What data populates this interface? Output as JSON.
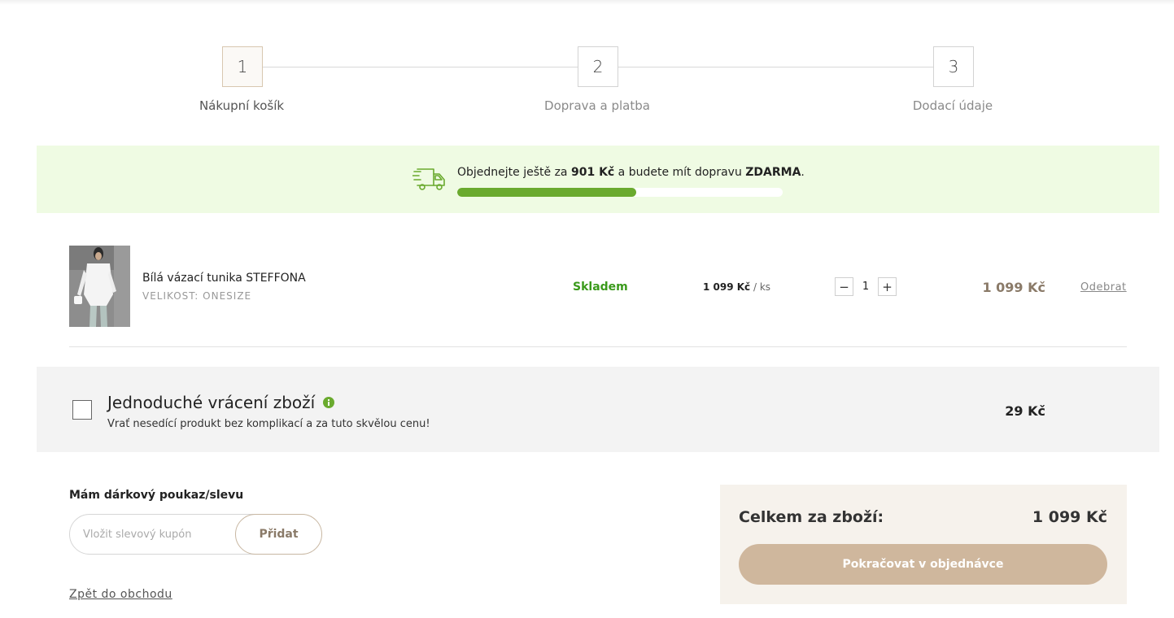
{
  "steps": [
    {
      "number": "1",
      "label": "Nákupní košík",
      "active": true
    },
    {
      "number": "2",
      "label": "Doprava a platba",
      "active": false
    },
    {
      "number": "3",
      "label": "Dodací údaje",
      "active": false
    }
  ],
  "shipping": {
    "text_before": "Objednejte ještě za",
    "remaining": "901 Kč",
    "text_middle": "a budete mít dopravu",
    "free_word": "ZDARMA",
    "text_after": ".",
    "progress_fraction": 0.55,
    "icon": "truck-icon",
    "accent_color": "#6aaa2e"
  },
  "cart": {
    "items": [
      {
        "name": "Bílá vázací tunika STEFFONA",
        "size": "VELIKOST: ONESIZE",
        "stock": "Skladem",
        "unit_price": "1 099 Kč",
        "unit_suffix": "/ ks",
        "quantity": "1",
        "qty_minus": "−",
        "qty_plus": "+",
        "line_total": "1 099 Kč",
        "remove_label": "Odebrat"
      }
    ]
  },
  "easy_return": {
    "title": "Jednoduché vrácení zboží",
    "description": "Vrať nesedící produkt bez komplikací a za tuto skvělou cenu!",
    "price": "29 Kč",
    "checked": false
  },
  "coupon": {
    "title": "Mám dárkový poukaz/slevu",
    "placeholder": "Vložit slevový kupón",
    "button_label": "Přidat"
  },
  "back_link": "Zpět do obchodu",
  "summary": {
    "label": "Celkem za zboží:",
    "value": "1 099 Kč",
    "continue_label": "Pokračovat v objednávce",
    "button_color": "#cfb79d"
  }
}
